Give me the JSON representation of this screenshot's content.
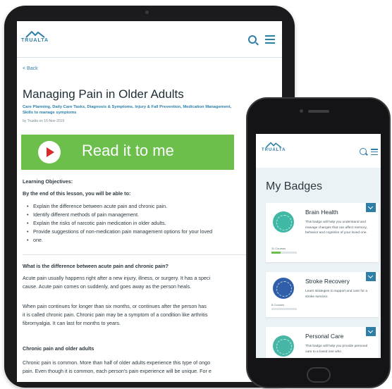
{
  "tablet": {
    "brand": "TRUALTA",
    "back_label": "< Back",
    "article_title": "Managing Pain in Older Adults",
    "tags_line1": "Care Planning, Daily Care Tasks, Diagnosis & Symptoms, Injury & Fall Prevention, Medication Management,",
    "tags_line2": "Skills to manage symptoms",
    "byline": "by Trualta on 16-Nov-2019",
    "read_button_label": "Read it to me",
    "objectives_heading": "Learning Objectives:",
    "objectives_intro": "By the end of this lesson, you will be able to:",
    "objectives": [
      "Explain the difference between acute pain and chronic pain.",
      "Identify different methods of pain management.",
      "Explain the risks of narcotic pain medication in older adults.",
      "Provide suggestions of non-medication pain management options for your loved",
      "one."
    ],
    "section1_heading": "What is the difference between acute pain and chronic pain?",
    "section1_p1_line1": "Acute pain usually happens right after a new injury, illness, or surgery. It has a speci",
    "section1_p1_line2": "cause. Acute pain comes on suddenly, and goes away as the person heals.",
    "section1_p2_line1": "When pain continues for longer than six months, or continues after the person has",
    "section1_p2_line2": "it is called chronic pain. Chronic pain may be a symptom of a condition like arthritis",
    "section1_p2_line3": "fibromyalgia. It can last for months to years.",
    "section2_heading": "Chronic pain and older adults",
    "section2_p1_line1": "Chronic pain is common. More than half of older adults experience this type of ongo",
    "section2_p1_line2": "pain. Even though it is common, each person's pain experience will be unique. For e"
  },
  "phone": {
    "brand": "TRUALTA",
    "page_title": "My Badges",
    "badges": [
      {
        "name": "Brain Health",
        "description": "This badge will help you understand and manage changes that can affect memory, behavior and cognition of your loved one.",
        "courses": "11 Courses",
        "progress": 0.35,
        "color": "#3fb9a6"
      },
      {
        "name": "Stroke Recovery",
        "description": "Learn strategies to support and care for a stroke survivor.",
        "courses": "8 Courses",
        "progress": 0,
        "color": "#2f5fa8"
      },
      {
        "name": "Personal Care",
        "description": "This badge will help you provide personal care to a loved one who",
        "courses": "",
        "progress": 0,
        "color": "#46b7a6"
      }
    ]
  },
  "colors": {
    "brand_blue": "#2d7fa8",
    "accent_green": "#6cbf4b",
    "play_red": "#d62b2b"
  }
}
